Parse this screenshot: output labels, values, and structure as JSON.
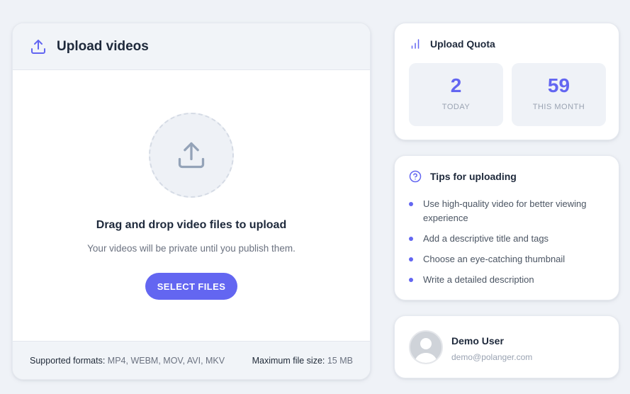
{
  "upload": {
    "title": "Upload videos",
    "drop_title": "Drag and drop video files to upload",
    "drop_subtitle": "Your videos will be private until you publish them.",
    "select_button": "SELECT FILES",
    "formats_label": "Supported formats:",
    "formats_value": "MP4, WEBM, MOV, AVI, MKV",
    "max_size_label": "Maximum file size:",
    "max_size_value": "15 MB"
  },
  "quota": {
    "title": "Upload Quota",
    "items": [
      {
        "value": "2",
        "label": "TODAY"
      },
      {
        "value": "59",
        "label": "THIS MONTH"
      }
    ]
  },
  "tips": {
    "title": "Tips for uploading",
    "items": [
      "Use high-quality video for better viewing experience",
      "Add a descriptive title and tags",
      "Choose an eye-catching thumbnail",
      "Write a detailed description"
    ]
  },
  "user": {
    "name": "Demo User",
    "email": "demo@polanger.com"
  },
  "colors": {
    "accent": "#6366f1",
    "background": "#eff2f7"
  },
  "icons": {
    "header": "upload-icon",
    "drop": "upload-icon",
    "quota": "bar-chart-icon",
    "tips": "help-circle-icon",
    "avatar": "user-avatar-icon"
  }
}
